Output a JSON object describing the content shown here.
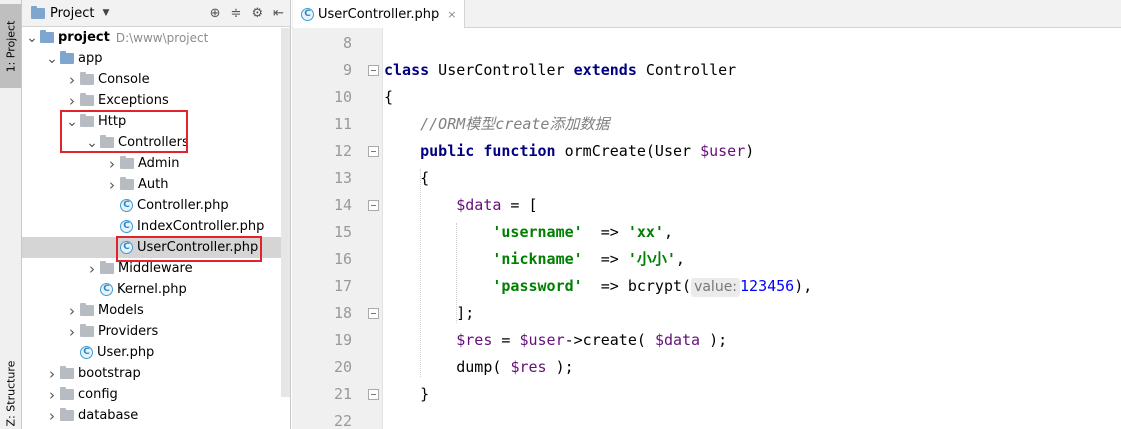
{
  "stripe": {
    "project_tab": "1: Project",
    "structure_tab": "Z: Structure"
  },
  "project_panel": {
    "title": "Project",
    "tree": [
      {
        "label": "project",
        "hint": "D:\\www\\project",
        "arrow": "down",
        "icon": "folder-icon",
        "color": "#7fa6cf"
      },
      {
        "label": "app",
        "arrow": "down",
        "icon": "folder-icon",
        "color": "#7fa6cf"
      },
      {
        "label": "Console",
        "arrow": "right",
        "icon": "folder-icon"
      },
      {
        "label": "Exceptions",
        "arrow": "right",
        "icon": "folder-icon"
      },
      {
        "label": "Http",
        "arrow": "down",
        "icon": "folder-icon"
      },
      {
        "label": "Controllers",
        "arrow": "down",
        "icon": "folder-icon"
      },
      {
        "label": "Admin",
        "arrow": "right",
        "icon": "folder-icon"
      },
      {
        "label": "Auth",
        "arrow": "right",
        "icon": "folder-icon"
      },
      {
        "label": "Controller.php",
        "icon": "php-class-icon"
      },
      {
        "label": "IndexController.php",
        "icon": "php-class-icon"
      },
      {
        "label": "UserController.php",
        "icon": "php-class-icon",
        "selected": true
      },
      {
        "label": "Middleware",
        "arrow": "right",
        "icon": "folder-icon"
      },
      {
        "label": "Kernel.php",
        "icon": "php-class-icon"
      },
      {
        "label": "Models",
        "arrow": "right",
        "icon": "folder-icon"
      },
      {
        "label": "Providers",
        "arrow": "right",
        "icon": "folder-icon"
      },
      {
        "label": "User.php",
        "icon": "php-class-icon"
      },
      {
        "label": "bootstrap",
        "arrow": "right",
        "icon": "folder-icon"
      },
      {
        "label": "config",
        "arrow": "right",
        "icon": "folder-icon"
      },
      {
        "label": "database",
        "arrow": "right",
        "icon": "folder-icon"
      }
    ]
  },
  "editor": {
    "tab_label": "UserController.php",
    "line_numbers": [
      "8",
      "9",
      "10",
      "11",
      "12",
      "13",
      "14",
      "15",
      "16",
      "17",
      "18",
      "19",
      "20",
      "21",
      "22"
    ],
    "lines": [
      [],
      [
        {
          "t": "class",
          "c": "kw"
        },
        {
          "t": " UserController "
        },
        {
          "t": "extends",
          "c": "kw"
        },
        {
          "t": " Controller"
        }
      ],
      [
        {
          "t": "{"
        }
      ],
      [
        {
          "t": "    "
        },
        {
          "t": "//ORM模型create添加数据",
          "c": "cmt"
        }
      ],
      [
        {
          "t": "    "
        },
        {
          "t": "public function",
          "c": "kw"
        },
        {
          "t": " ormCreate(User "
        },
        {
          "t": "$user",
          "c": "var"
        },
        {
          "t": ")"
        }
      ],
      [
        {
          "t": "    {"
        }
      ],
      [
        {
          "t": "        "
        },
        {
          "t": "$data",
          "c": "var"
        },
        {
          "t": " = ["
        }
      ],
      [
        {
          "t": "            "
        },
        {
          "t": "'username'",
          "c": "str"
        },
        {
          "t": "  => "
        },
        {
          "t": "'xx'",
          "c": "str"
        },
        {
          "t": ","
        }
      ],
      [
        {
          "t": "            "
        },
        {
          "t": "'nickname'",
          "c": "str"
        },
        {
          "t": "  => "
        },
        {
          "t": "'小小'",
          "c": "str"
        },
        {
          "t": ","
        }
      ],
      [
        {
          "t": "            "
        },
        {
          "t": "'password'",
          "c": "str"
        },
        {
          "t": "  => bcrypt("
        },
        {
          "t": "value:",
          "c": "hint"
        },
        {
          "t": "123456",
          "c": "num"
        },
        {
          "t": "),"
        }
      ],
      [
        {
          "t": "        ];"
        }
      ],
      [
        {
          "t": "        "
        },
        {
          "t": "$res",
          "c": "var"
        },
        {
          "t": " = "
        },
        {
          "t": "$user",
          "c": "var"
        },
        {
          "t": "->create( "
        },
        {
          "t": "$data",
          "c": "var"
        },
        {
          "t": " );"
        }
      ],
      [
        {
          "t": "        dump( "
        },
        {
          "t": "$res",
          "c": "var"
        },
        {
          "t": " );"
        }
      ],
      [
        {
          "t": "    }"
        }
      ],
      []
    ]
  },
  "colors": {
    "keyword": "#000080",
    "variable": "#660e7a",
    "string": "#008000",
    "comment": "#808080",
    "number": "#0000ff",
    "highlight_box": "#e0242b"
  }
}
